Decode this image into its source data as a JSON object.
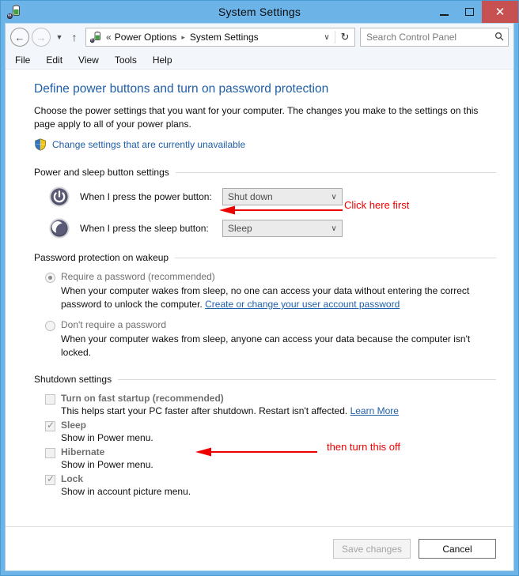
{
  "window": {
    "title": "System Settings",
    "icon": "power-plug-icon",
    "controls": {
      "minimize": "minimize-icon",
      "maximize": "maximize-icon",
      "close": "✕"
    }
  },
  "nav": {
    "back": "←",
    "forward": "→",
    "history_caret": "▼",
    "up": "↑",
    "address": {
      "icon": "power-plug-icon",
      "chevrons": "«",
      "segments": [
        "Power Options",
        "System Settings"
      ],
      "separator": "▸",
      "dropdown": "∨",
      "refresh": "↻"
    },
    "search": {
      "placeholder": "Search Control Panel",
      "icon": "search-icon"
    }
  },
  "menubar": {
    "items": [
      "File",
      "Edit",
      "View",
      "Tools",
      "Help"
    ]
  },
  "page": {
    "title": "Define power buttons and turn on password protection",
    "intro": "Choose the power settings that you want for your computer. The changes you make to the settings on this page apply to all of your power plans.",
    "admin_link": "Change settings that are currently unavailable"
  },
  "sections": {
    "power_buttons": {
      "label": "Power and sleep button settings",
      "rows": [
        {
          "icon": "power-button-icon",
          "label": "When I press the power button:",
          "value": "Shut down",
          "arrow": "∨",
          "disabled": true
        },
        {
          "icon": "sleep-moon-icon",
          "label": "When I press the sleep button:",
          "value": "Sleep",
          "arrow": "∨",
          "disabled": true
        }
      ]
    },
    "password_protection": {
      "label": "Password protection on wakeup",
      "options": [
        {
          "title": "Require a password (recommended)",
          "checked": true,
          "desc_before": "When your computer wakes from sleep, no one can access your data without entering the correct password to unlock the computer. ",
          "link": "Create or change your user account password",
          "desc_after": ""
        },
        {
          "title": "Don't require a password",
          "checked": false,
          "desc_before": "When your computer wakes from sleep, anyone can access your data because the computer isn't locked.",
          "link": "",
          "desc_after": ""
        }
      ]
    },
    "shutdown": {
      "label": "Shutdown settings",
      "items": [
        {
          "title": "Turn on fast startup (recommended)",
          "checked": false,
          "desc_before": "This helps start your PC faster after shutdown. Restart isn't affected. ",
          "link": "Learn More",
          "desc_after": ""
        },
        {
          "title": "Sleep",
          "checked": true,
          "desc_before": "Show in Power menu.",
          "link": "",
          "desc_after": ""
        },
        {
          "title": "Hibernate",
          "checked": false,
          "desc_before": "Show in Power menu.",
          "link": "",
          "desc_after": ""
        },
        {
          "title": "Lock",
          "checked": true,
          "desc_before": "Show in account picture menu.",
          "link": "",
          "desc_after": ""
        }
      ]
    }
  },
  "footer": {
    "save_label": "Save changes",
    "save_disabled": true,
    "cancel_label": "Cancel"
  },
  "annotations": {
    "color": "#ee0000",
    "first": "Click here first",
    "second": "then turn this off"
  }
}
